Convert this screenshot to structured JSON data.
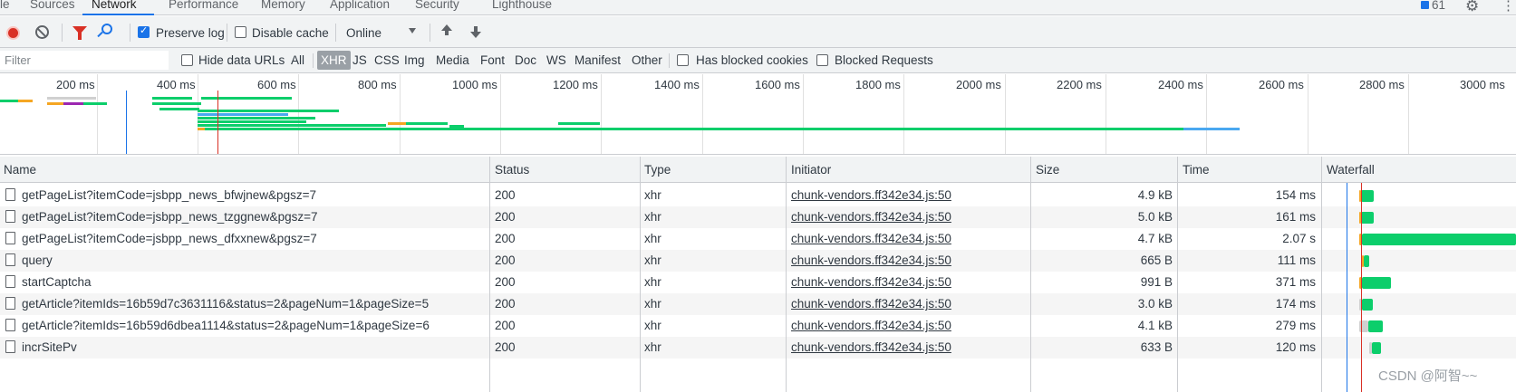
{
  "tabs": [
    {
      "label": "le",
      "active": false
    },
    {
      "label": "Sources",
      "active": false
    },
    {
      "label": "Network",
      "active": true
    },
    {
      "label": "Performance",
      "active": false
    },
    {
      "label": "Memory",
      "active": false
    },
    {
      "label": "Application",
      "active": false
    },
    {
      "label": "Security",
      "active": false
    },
    {
      "label": "Lighthouse",
      "active": false
    }
  ],
  "issues_count": "61",
  "toolbar": {
    "preserve_log_label": "Preserve log",
    "preserve_log_checked": true,
    "disable_cache_label": "Disable cache",
    "disable_cache_checked": false,
    "throttling_value": "Online"
  },
  "filterbar": {
    "filter_placeholder": "Filter",
    "hide_data_urls_label": "Hide data URLs",
    "types": [
      "All",
      "XHR",
      "JS",
      "CSS",
      "Img",
      "Media",
      "Font",
      "Doc",
      "WS",
      "Manifest",
      "Other"
    ],
    "selected_type": "XHR",
    "has_blocked_cookies_label": "Has blocked cookies",
    "blocked_requests_label": "Blocked Requests"
  },
  "overview": {
    "ticks": [
      "200 ms",
      "400 ms",
      "600 ms",
      "800 ms",
      "1000 ms",
      "1200 ms",
      "1400 ms",
      "1600 ms",
      "1800 ms",
      "2000 ms",
      "2200 ms",
      "2400 ms",
      "2600 ms",
      "2800 ms",
      "3000 ms"
    ]
  },
  "table": {
    "columns": [
      "Name",
      "Status",
      "Type",
      "Initiator",
      "Size",
      "Time",
      "Waterfall"
    ],
    "rows": [
      {
        "name": "getPageList?itemCode=jsbpp_news_bfwjnew&pgsz=7",
        "status": "200",
        "type": "xhr",
        "initiator": "chunk-vendors.ff342e34.js:50",
        "size": "4.9 kB",
        "time": "154 ms"
      },
      {
        "name": "getPageList?itemCode=jsbpp_news_tzggnew&pgsz=7",
        "status": "200",
        "type": "xhr",
        "initiator": "chunk-vendors.ff342e34.js:50",
        "size": "5.0 kB",
        "time": "161 ms"
      },
      {
        "name": "getPageList?itemCode=jsbpp_news_dfxxnew&pgsz=7",
        "status": "200",
        "type": "xhr",
        "initiator": "chunk-vendors.ff342e34.js:50",
        "size": "4.7 kB",
        "time": "2.07 s"
      },
      {
        "name": "query",
        "status": "200",
        "type": "xhr",
        "initiator": "chunk-vendors.ff342e34.js:50",
        "size": "665 B",
        "time": "111 ms"
      },
      {
        "name": "startCaptcha",
        "status": "200",
        "type": "xhr",
        "initiator": "chunk-vendors.ff342e34.js:50",
        "size": "991 B",
        "time": "371 ms"
      },
      {
        "name": "getArticle?itemIds=16b59d7c3631116&status=2&pageNum=1&pageSize=5",
        "status": "200",
        "type": "xhr",
        "initiator": "chunk-vendors.ff342e34.js:50",
        "size": "3.0 kB",
        "time": "174 ms"
      },
      {
        "name": "getArticle?itemIds=16b59d6dbea1114&status=2&pageNum=1&pageSize=6",
        "status": "200",
        "type": "xhr",
        "initiator": "chunk-vendors.ff342e34.js:50",
        "size": "4.1 kB",
        "time": "279 ms"
      },
      {
        "name": "incrSitePv",
        "status": "200",
        "type": "xhr",
        "initiator": "chunk-vendors.ff342e34.js:50",
        "size": "633 B",
        "time": "120 ms"
      }
    ]
  },
  "watermark": "CSDN @阿智~~",
  "colors": {
    "accent": "#1a73e8",
    "record": "#d93025",
    "waterfall_green": "#0cce6b",
    "waiting_orange": "#f5a623",
    "download_blue": "#4aa8f0",
    "load_line": "#d93025",
    "dcl_line": "#1a73e8"
  }
}
